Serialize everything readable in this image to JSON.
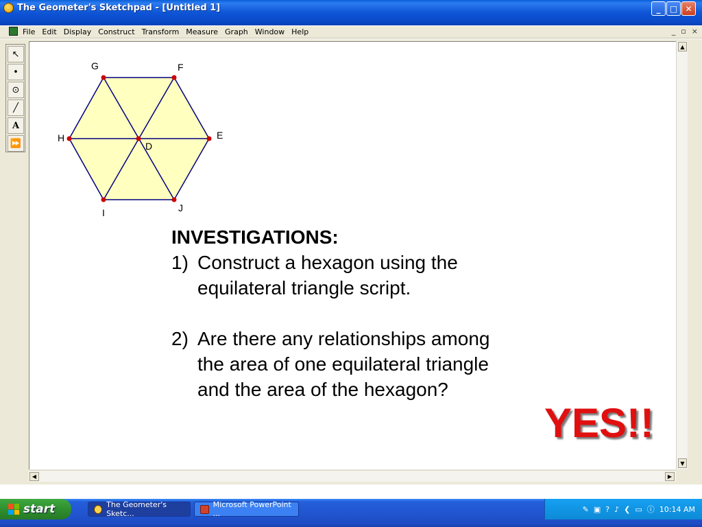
{
  "window": {
    "title": "The Geometer's Sketchpad - [Untitled 1]",
    "buttons": {
      "minimize": "_",
      "maximize": "□",
      "close": "✕"
    }
  },
  "menubar": {
    "items": [
      "File",
      "Edit",
      "Display",
      "Construct",
      "Transform",
      "Measure",
      "Graph",
      "Window",
      "Help"
    ],
    "mdi": [
      "_",
      "▫",
      "×"
    ]
  },
  "toolbox": {
    "tools": [
      {
        "name": "selection-arrow-tool",
        "glyph": "↖"
      },
      {
        "name": "point-tool",
        "glyph": "•"
      },
      {
        "name": "compass-tool",
        "glyph": "⊙"
      },
      {
        "name": "straightedge-tool",
        "glyph": "╱"
      },
      {
        "name": "text-tool",
        "glyph": "A"
      },
      {
        "name": "custom-tool",
        "glyph": "⏩"
      }
    ]
  },
  "sketch": {
    "points": [
      "G",
      "F",
      "E",
      "D",
      "H",
      "I",
      "J"
    ],
    "fill_color": "#ffffc0",
    "line_color": "#000080",
    "point_color": "#cc0000"
  },
  "content": {
    "heading": "INVESTIGATIONS:",
    "item1_num": "1)",
    "item1_line1": "Construct a hexagon using the",
    "item1_line2": "equilateral triangle script.",
    "item2_num": "2)",
    "item2_line1": "Are there any relationships among",
    "item2_line2": "the area of one equilateral triangle",
    "item2_line3": "and the area of the hexagon?",
    "answer": "YES!!"
  },
  "taskbar": {
    "start": "start",
    "tasks": [
      "The Geometer's Sketc...",
      "Microsoft PowerPoint ..."
    ],
    "clock": "10:14 AM"
  }
}
